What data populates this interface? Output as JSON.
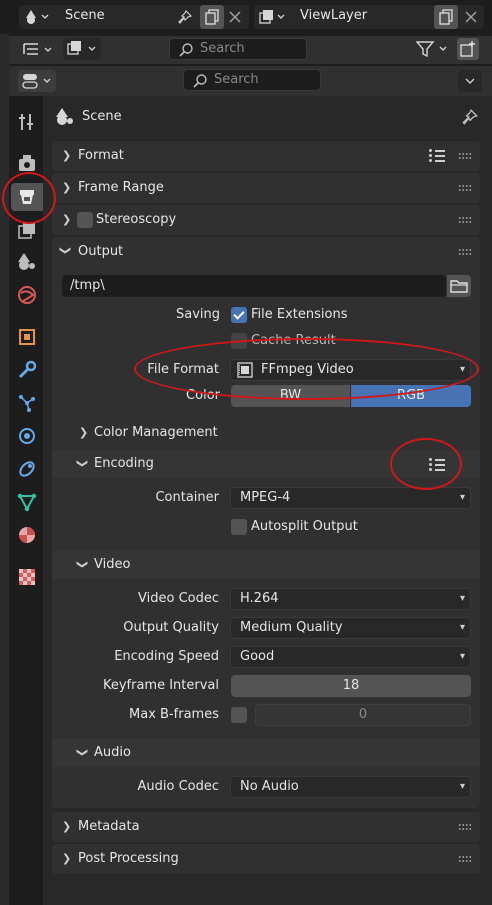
{
  "topbar": {
    "scene_name": "Scene",
    "viewlayer_name": "ViewLayer"
  },
  "outliner_bar": {
    "search_placeholder": "Search"
  },
  "properties_bar": {
    "search_placeholder": "Search"
  },
  "context": {
    "title": "Scene"
  },
  "panels": {
    "format": "Format",
    "frame_range": "Frame Range",
    "stereoscopy": "Stereoscopy",
    "output": "Output",
    "metadata": "Metadata",
    "post_processing": "Post Processing"
  },
  "output": {
    "path": "/tmp\\",
    "saving_label": "Saving",
    "file_extensions_label": "File Extensions",
    "file_extensions_checked": true,
    "cache_result_label": "Cache Result",
    "cache_result_checked": false,
    "file_format_label": "File Format",
    "file_format_value": "FFmpeg Video",
    "color_label": "Color",
    "color_options": [
      "BW",
      "RGB"
    ],
    "color_selected": "RGB",
    "color_management_label": "Color Management"
  },
  "encoding": {
    "label": "Encoding",
    "container_label": "Container",
    "container_value": "MPEG-4",
    "autosplit_label": "Autosplit Output",
    "autosplit_checked": false
  },
  "video": {
    "label": "Video",
    "codec_label": "Video Codec",
    "codec_value": "H.264",
    "quality_label": "Output Quality",
    "quality_value": "Medium Quality",
    "speed_label": "Encoding Speed",
    "speed_value": "Good",
    "keyframe_label": "Keyframe Interval",
    "keyframe_value": "18",
    "bframes_label": "Max B-frames",
    "bframes_checked": false,
    "bframes_value": "0"
  },
  "audio": {
    "label": "Audio",
    "codec_label": "Audio Codec",
    "codec_value": "No Audio"
  },
  "colors": {
    "accent": "#4772b3",
    "annotation": "#d01818",
    "panel": "#303030",
    "background": "#1d1d1d"
  },
  "icons": [
    "scene-icon",
    "render-layers-icon",
    "pin-icon",
    "new-icon",
    "close-icon",
    "editor-type-icon",
    "display-mode-icon",
    "search-icon",
    "filter-icon",
    "add-collection-icon",
    "tool-tab-icon",
    "render-tab-icon",
    "output-tab-icon",
    "view-layer-tab-icon",
    "scene-tab-icon",
    "world-tab-icon",
    "object-tab-icon",
    "modifier-tab-icon",
    "particles-tab-icon",
    "physics-tab-icon",
    "constraints-tab-icon",
    "data-tab-icon",
    "material-tab-icon",
    "texture-tab-icon",
    "list-menu-icon",
    "folder-icon",
    "film-icon"
  ]
}
